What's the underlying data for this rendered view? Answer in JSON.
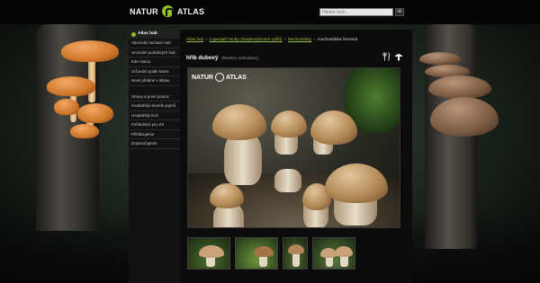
{
  "logo": {
    "left_word": "NATUR",
    "right_word": "ATLAS"
  },
  "search": {
    "placeholder": "Hledat druh...",
    "button": "ok"
  },
  "sidebar": {
    "heading": "Atlas hub",
    "group1": [
      "Abecední seznam hub",
      "Srovnání podobných hub",
      "Kde rostou",
      "Určování podle barev",
      "Nové přidané v atlasu"
    ],
    "group2": [
      "Otravy a první pomoc",
      "Houbařský slovník pojmů",
      "Houbařský kvíz",
      "Pohlednice pro ZS",
      "Přihlásujeme",
      "Doporučujeme"
    ]
  },
  "breadcrumb": {
    "items": [
      "Atlas hub",
      "Lupenaté houby (Stopkovýtrusné vyšší)",
      "Muchomůrky"
    ],
    "current": "muchomůrka červená"
  },
  "species": {
    "name": "hřib dubový",
    "latin": "(Boletus reticulatus)"
  },
  "photo_watermark": {
    "left_word": "NATUR",
    "right_word": "ATLAS"
  },
  "icons": {
    "tool1": "cutlery-icon",
    "tool2": "mushroom-icon"
  },
  "colors": {
    "accent": "#8fbf28",
    "link": "#9cc34a",
    "page_bg": "#000000"
  }
}
